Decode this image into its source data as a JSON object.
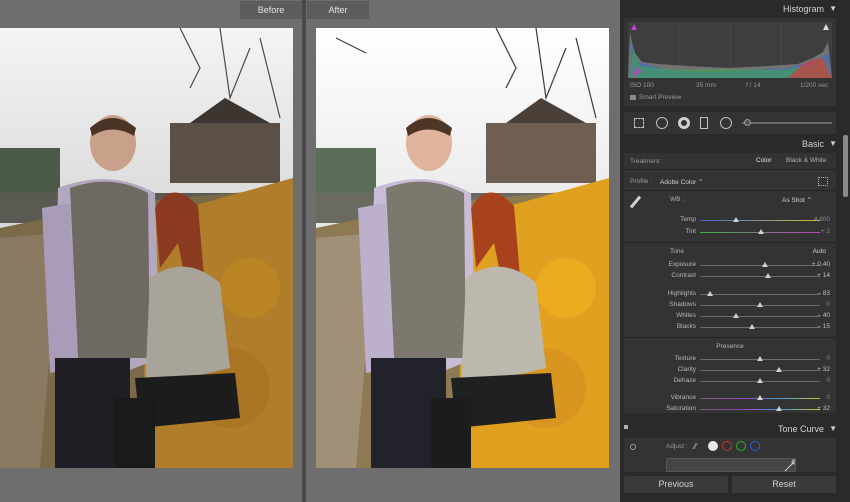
{
  "compare": {
    "before_label": "Before",
    "after_label": "After"
  },
  "histogram": {
    "title": "Histogram",
    "iso": "ISO 100",
    "focal": "35 mm",
    "aperture": "f / 14",
    "shutter": "1/200 sec",
    "smart_preview": "Smart Preview"
  },
  "basic": {
    "title": "Basic",
    "treatment_label": "Treatment :",
    "treatment_color": "Color",
    "treatment_bw": "Black & White",
    "profile_label": "Profile :",
    "profile_value": "Adobe Color ⌃",
    "wb_label": "WB :",
    "wb_value": "As Shot ⌃",
    "temp": {
      "label": "Temp",
      "value": "4,800",
      "level": 0.3
    },
    "tint": {
      "label": "Tint",
      "value": "+ 2",
      "level": 0.51
    },
    "tone_label": "Tone",
    "auto_label": "Auto",
    "exposure": {
      "label": "Exposure",
      "value": "+ 0.40",
      "level": 0.54
    },
    "contrast": {
      "label": "Contrast",
      "value": "+ 14",
      "level": 0.57
    },
    "highlights": {
      "label": "Highlights",
      "value": "– 83",
      "level": 0.08
    },
    "shadows": {
      "label": "Shadows",
      "value": "0",
      "level": 0.5
    },
    "whites": {
      "label": "Whites",
      "value": "– 40",
      "level": 0.3
    },
    "blacks": {
      "label": "Blacks",
      "value": "– 15",
      "level": 0.43
    },
    "presence_label": "Presence",
    "texture": {
      "label": "Texture",
      "value": "0",
      "level": 0.5
    },
    "clarity": {
      "label": "Clarity",
      "value": "+ 32",
      "level": 0.66
    },
    "dehaze": {
      "label": "Dehaze",
      "value": "0",
      "level": 0.5
    },
    "vibrance": {
      "label": "Vibrance",
      "value": "0",
      "level": 0.5
    },
    "saturation": {
      "label": "Saturation",
      "value": "+ 32",
      "level": 0.66
    }
  },
  "tone_curve": {
    "title": "Tone Curve",
    "adjust_label": "Adjust :"
  },
  "buttons": {
    "previous": "Previous",
    "reset": "Reset"
  },
  "colors": {
    "panel_bg": "#2a2a2a",
    "photo_area_bg": "#6e6e6e",
    "foliage": "#e0a020"
  }
}
